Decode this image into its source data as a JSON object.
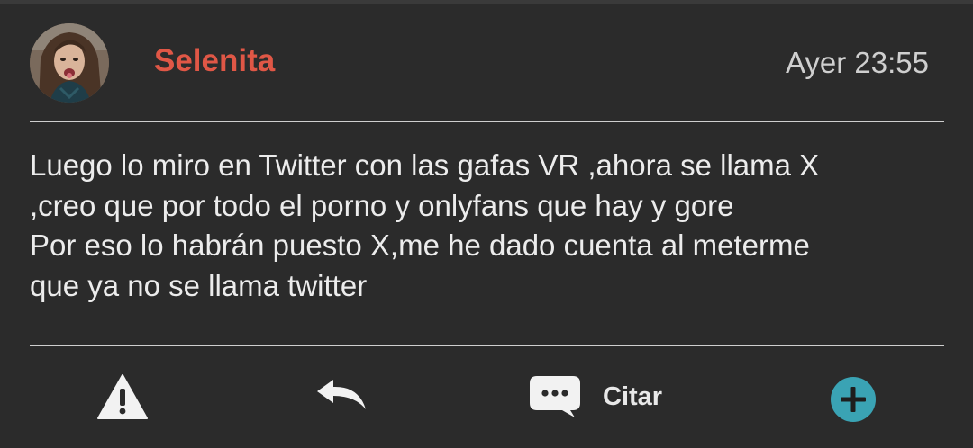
{
  "post": {
    "author": "Selenita",
    "timestamp": "Ayer 23:55",
    "avatar_icon": "user-avatar-photo",
    "lines": [
      "Luego lo miro en Twitter con las gafas VR ,ahora se llama X",
      ",creo que por todo el porno y onlyfans que hay y gore",
      "Por eso lo habrán puesto X,me he dado cuenta al meterme",
      "que ya no se llama twitter"
    ]
  },
  "actions": {
    "report_icon": "warning-icon",
    "reply_icon": "reply-arrow-icon",
    "quote_icon": "speech-bubble-icon",
    "quote_label": "Citar",
    "add_icon": "plus-circle-icon"
  },
  "colors": {
    "background": "#2b2b2b",
    "author": "#e05746",
    "accent": "#3aa3b4",
    "text": "#ececec"
  }
}
